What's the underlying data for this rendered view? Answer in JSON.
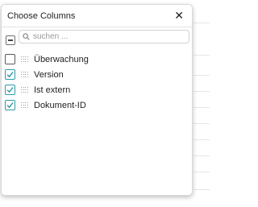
{
  "dialog": {
    "title": "Choose Columns",
    "close_glyph": "✕",
    "search_placeholder": "suchen ...",
    "columns": [
      {
        "label": "Überwachung",
        "checked": false
      },
      {
        "label": "Version",
        "checked": true
      },
      {
        "label": "Ist extern",
        "checked": true
      },
      {
        "label": "Dokument-ID",
        "checked": true
      }
    ]
  },
  "colors": {
    "accent": "#2f9aa8",
    "border": "#d9d9d9"
  },
  "icons": {
    "search": "search-icon",
    "close": "close-icon",
    "drag": "drag-handle-icon"
  }
}
